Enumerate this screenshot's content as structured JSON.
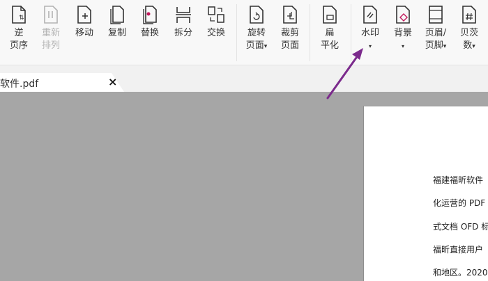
{
  "toolbar": {
    "tools": [
      {
        "name": "reverse-pages",
        "line1": "逆",
        "line2": "页序",
        "enabled": true
      },
      {
        "name": "rearrange",
        "line1": "重新",
        "line2": "排列",
        "enabled": false
      },
      {
        "name": "move",
        "line1": "移动",
        "line2": "",
        "enabled": true
      },
      {
        "name": "copy",
        "line1": "复制",
        "line2": "",
        "enabled": true
      },
      {
        "name": "replace",
        "line1": "替换",
        "line2": "",
        "enabled": true
      },
      {
        "name": "split",
        "line1": "拆分",
        "line2": "",
        "enabled": true
      },
      {
        "name": "swap",
        "line1": "交换",
        "line2": "",
        "enabled": true
      },
      {
        "name": "rotate-pages",
        "line1": "旋转",
        "line2": "页面",
        "enabled": true,
        "dropdown": true
      },
      {
        "name": "crop-pages",
        "line1": "裁剪",
        "line2": "页面",
        "enabled": true
      },
      {
        "name": "flatten",
        "line1": "扁",
        "line2": "平化",
        "enabled": true
      },
      {
        "name": "watermark",
        "line1": "水印",
        "line2": "",
        "enabled": true,
        "dropdown": true
      },
      {
        "name": "background",
        "line1": "背景",
        "line2": "",
        "enabled": true,
        "dropdown": true
      },
      {
        "name": "header-footer",
        "line1": "页眉/",
        "line2": "页脚",
        "enabled": true,
        "dropdown": true
      },
      {
        "name": "bates",
        "line1": "贝茨",
        "line2": "数",
        "enabled": true,
        "dropdown": true
      }
    ],
    "caret": "▾"
  },
  "tab": {
    "title": "软件.pdf",
    "close": "×"
  },
  "document": {
    "lines": [
      "福建福昕软件",
      "化运营的 PDF",
      "式文档 OFD 标",
      "福昕直接用户",
      "和地区。2020"
    ]
  },
  "colors": {
    "annotation_arrow": "#7b2a8c",
    "doc_background": "#a6a6a6",
    "ribbon_background": "#f8f8f8"
  }
}
